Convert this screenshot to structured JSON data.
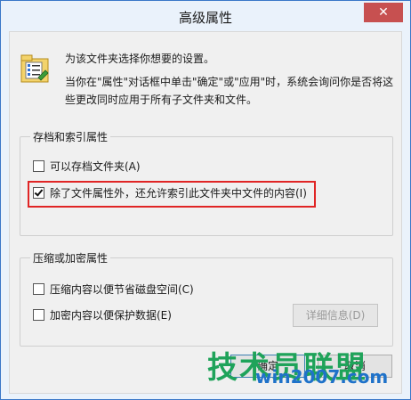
{
  "window": {
    "title": "高级属性",
    "close_glyph": "✕"
  },
  "intro": {
    "line1": "为该文件夹选择你想要的设置。",
    "line2": "当你在\"属性\"对话框中单击\"确定\"或\"应用\"时，系统会询问你是否将这些更改同时应用于所有子文件夹和文件。"
  },
  "archive_group": {
    "title": "存档和索引属性",
    "options": [
      {
        "label": "可以存档文件夹(A)",
        "checked": false
      },
      {
        "label": "除了文件属性外，还允许索引此文件夹中文件的内容(I)",
        "checked": true
      }
    ]
  },
  "compress_group": {
    "title": "压缩或加密属性",
    "options": [
      {
        "label": "压缩内容以便节省磁盘空间(C)",
        "checked": false
      },
      {
        "label": "加密内容以便保护数据(E)",
        "checked": false
      }
    ],
    "details_label": "详细信息(D)"
  },
  "buttons": {
    "ok": "确定",
    "cancel": "取消"
  },
  "watermark": {
    "text": "技术员联盟",
    "url": "win2007.com"
  },
  "colors": {
    "highlight": "#e02525",
    "title_bar": "#eaf2fb",
    "close": "#c75050",
    "watermark_green": "#1fa35a",
    "watermark_blue": "#1f72c9"
  }
}
